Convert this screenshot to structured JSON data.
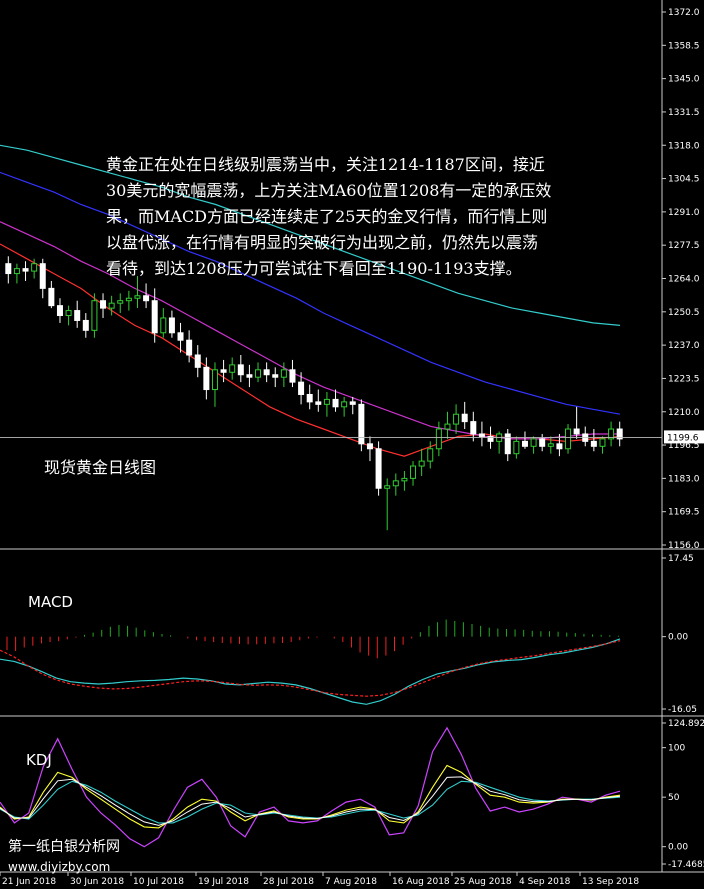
{
  "chart_data": {
    "type": "candlestick",
    "annotation_lines": [
      "黄金正在处在日线级别震荡当中，关注1214-1187区间，接近",
      "30美元的宽幅震荡，上方关注MA60位置1208有一定的承压效",
      "果，而MACD方面已经连续走了25天的金叉行情，而行情上则",
      "以盘代涨，在行情有明显的突破行为出现之前，仍然先以震荡",
      "看待，到达1208压力可尝试往下看回至1190-1193支撑。"
    ],
    "chart_label": "现货黄金日线图",
    "current_price": "1199.6",
    "price_ticks": [
      "1372.0",
      "1358.5",
      "1345.0",
      "1331.5",
      "1318.0",
      "1304.5",
      "1291.0",
      "1277.5",
      "1264.0",
      "1250.5",
      "1237.0",
      "1223.5",
      "1210.0",
      "1196.5",
      "1183.0",
      "1169.5",
      "1156.0"
    ],
    "ylim": [
      1156.0,
      1372.0
    ],
    "x_ticks": [
      "21 Jun 2018",
      "30 Jun 2018",
      "10 Jul 2018",
      "19 Jul 2018",
      "28 Jul 2018",
      "7 Aug 2018",
      "16 Aug 2018",
      "25 Aug 2018",
      "4 Sep 2018",
      "13 Sep 2018"
    ],
    "candles": [
      {
        "o": 1270,
        "h": 1273,
        "l": 1262,
        "c": 1266
      },
      {
        "o": 1266,
        "h": 1270,
        "l": 1262,
        "c": 1268
      },
      {
        "o": 1268,
        "h": 1271,
        "l": 1263,
        "c": 1267
      },
      {
        "o": 1267,
        "h": 1272,
        "l": 1264,
        "c": 1270
      },
      {
        "o": 1270,
        "h": 1272,
        "l": 1256,
        "c": 1260
      },
      {
        "o": 1260,
        "h": 1263,
        "l": 1252,
        "c": 1253
      },
      {
        "o": 1253,
        "h": 1256,
        "l": 1246,
        "c": 1249
      },
      {
        "o": 1249,
        "h": 1253,
        "l": 1245,
        "c": 1251
      },
      {
        "o": 1251,
        "h": 1255,
        "l": 1244,
        "c": 1247
      },
      {
        "o": 1247,
        "h": 1250,
        "l": 1240,
        "c": 1243
      },
      {
        "o": 1243,
        "h": 1258,
        "l": 1240,
        "c": 1255
      },
      {
        "o": 1255,
        "h": 1258,
        "l": 1248,
        "c": 1252
      },
      {
        "o": 1252,
        "h": 1257,
        "l": 1249,
        "c": 1254
      },
      {
        "o": 1254,
        "h": 1258,
        "l": 1250,
        "c": 1255
      },
      {
        "o": 1255,
        "h": 1259,
        "l": 1251,
        "c": 1256
      },
      {
        "o": 1256,
        "h": 1265,
        "l": 1252,
        "c": 1257
      },
      {
        "o": 1257,
        "h": 1262,
        "l": 1252,
        "c": 1255
      },
      {
        "o": 1255,
        "h": 1260,
        "l": 1238,
        "c": 1242
      },
      {
        "o": 1242,
        "h": 1252,
        "l": 1240,
        "c": 1248
      },
      {
        "o": 1248,
        "h": 1251,
        "l": 1240,
        "c": 1242
      },
      {
        "o": 1242,
        "h": 1246,
        "l": 1234,
        "c": 1239
      },
      {
        "o": 1239,
        "h": 1243,
        "l": 1230,
        "c": 1233
      },
      {
        "o": 1233,
        "h": 1237,
        "l": 1224,
        "c": 1228
      },
      {
        "o": 1228,
        "h": 1232,
        "l": 1215,
        "c": 1219
      },
      {
        "o": 1219,
        "h": 1230,
        "l": 1212,
        "c": 1227
      },
      {
        "o": 1227,
        "h": 1231,
        "l": 1222,
        "c": 1226
      },
      {
        "o": 1226,
        "h": 1232,
        "l": 1223,
        "c": 1229
      },
      {
        "o": 1229,
        "h": 1233,
        "l": 1222,
        "c": 1225
      },
      {
        "o": 1225,
        "h": 1229,
        "l": 1220,
        "c": 1224
      },
      {
        "o": 1224,
        "h": 1230,
        "l": 1222,
        "c": 1227
      },
      {
        "o": 1227,
        "h": 1230,
        "l": 1222,
        "c": 1225
      },
      {
        "o": 1225,
        "h": 1228,
        "l": 1220,
        "c": 1224
      },
      {
        "o": 1224,
        "h": 1230,
        "l": 1220,
        "c": 1227
      },
      {
        "o": 1227,
        "h": 1231,
        "l": 1220,
        "c": 1222
      },
      {
        "o": 1222,
        "h": 1226,
        "l": 1213,
        "c": 1217
      },
      {
        "o": 1217,
        "h": 1221,
        "l": 1211,
        "c": 1214
      },
      {
        "o": 1214,
        "h": 1219,
        "l": 1210,
        "c": 1213
      },
      {
        "o": 1213,
        "h": 1218,
        "l": 1208,
        "c": 1215
      },
      {
        "o": 1215,
        "h": 1219,
        "l": 1210,
        "c": 1212
      },
      {
        "o": 1212,
        "h": 1216,
        "l": 1208,
        "c": 1214
      },
      {
        "o": 1214,
        "h": 1216,
        "l": 1209,
        "c": 1213
      },
      {
        "o": 1213,
        "h": 1215,
        "l": 1194,
        "c": 1197
      },
      {
        "o": 1197,
        "h": 1200,
        "l": 1190,
        "c": 1195
      },
      {
        "o": 1195,
        "h": 1198,
        "l": 1176,
        "c": 1179
      },
      {
        "o": 1179,
        "h": 1183,
        "l": 1162,
        "c": 1180
      },
      {
        "o": 1180,
        "h": 1185,
        "l": 1176,
        "c": 1182
      },
      {
        "o": 1182,
        "h": 1186,
        "l": 1178,
        "c": 1183
      },
      {
        "o": 1183,
        "h": 1190,
        "l": 1180,
        "c": 1188
      },
      {
        "o": 1188,
        "h": 1195,
        "l": 1184,
        "c": 1190
      },
      {
        "o": 1190,
        "h": 1198,
        "l": 1187,
        "c": 1195
      },
      {
        "o": 1195,
        "h": 1206,
        "l": 1192,
        "c": 1203
      },
      {
        "o": 1203,
        "h": 1210,
        "l": 1199,
        "c": 1205
      },
      {
        "o": 1205,
        "h": 1213,
        "l": 1201,
        "c": 1209
      },
      {
        "o": 1209,
        "h": 1214,
        "l": 1203,
        "c": 1206
      },
      {
        "o": 1206,
        "h": 1210,
        "l": 1198,
        "c": 1201
      },
      {
        "o": 1201,
        "h": 1206,
        "l": 1196,
        "c": 1200
      },
      {
        "o": 1200,
        "h": 1204,
        "l": 1195,
        "c": 1198
      },
      {
        "o": 1198,
        "h": 1202,
        "l": 1193,
        "c": 1201
      },
      {
        "o": 1201,
        "h": 1203,
        "l": 1190,
        "c": 1193
      },
      {
        "o": 1193,
        "h": 1200,
        "l": 1191,
        "c": 1198
      },
      {
        "o": 1198,
        "h": 1202,
        "l": 1195,
        "c": 1196
      },
      {
        "o": 1196,
        "h": 1200,
        "l": 1193,
        "c": 1199
      },
      {
        "o": 1199,
        "h": 1201,
        "l": 1194,
        "c": 1196
      },
      {
        "o": 1196,
        "h": 1200,
        "l": 1193,
        "c": 1197
      },
      {
        "o": 1197,
        "h": 1201,
        "l": 1192,
        "c": 1195
      },
      {
        "o": 1195,
        "h": 1205,
        "l": 1193,
        "c": 1203
      },
      {
        "o": 1203,
        "h": 1212,
        "l": 1199,
        "c": 1201
      },
      {
        "o": 1201,
        "h": 1204,
        "l": 1196,
        "c": 1198
      },
      {
        "o": 1198,
        "h": 1203,
        "l": 1194,
        "c": 1196
      },
      {
        "o": 1196,
        "h": 1200,
        "l": 1193,
        "c": 1199
      },
      {
        "o": 1199,
        "h": 1206,
        "l": 1196,
        "c": 1203
      },
      {
        "o": 1203,
        "h": 1206,
        "l": 1196,
        "c": 1199
      }
    ],
    "ma_series": [
      {
        "color": "#ff3030",
        "values": [
          1278,
          1272,
          1266,
          1260,
          1252,
          1245,
          1240,
          1233,
          1226,
          1219,
          1212,
          1207,
          1203,
          1199,
          1195,
          1192,
          1196,
          1200,
          1201,
          1199,
          1199,
          1198,
          1199,
          1200
        ]
      },
      {
        "color": "#cc33cc",
        "values": [
          1287,
          1282,
          1277,
          1271,
          1266,
          1260,
          1255,
          1249,
          1243,
          1237,
          1231,
          1225,
          1220,
          1216,
          1212,
          1208,
          1204,
          1202,
          1200,
          1199,
          1199,
          1200,
          1201,
          1201
        ]
      },
      {
        "color": "#3333ff",
        "values": [
          1307,
          1303,
          1299,
          1294,
          1290,
          1285,
          1280,
          1275,
          1271,
          1266,
          1261,
          1256,
          1250,
          1245,
          1240,
          1235,
          1230,
          1226,
          1222,
          1219,
          1216,
          1213,
          1211,
          1209
        ]
      },
      {
        "color": "#33cccc",
        "values": [
          1318,
          1316,
          1313,
          1310,
          1307,
          1304,
          1301,
          1297,
          1294,
          1290,
          1286,
          1282,
          1278,
          1274,
          1270,
          1266,
          1262,
          1258,
          1255,
          1252,
          1250,
          1248,
          1246,
          1245
        ]
      }
    ],
    "macd": {
      "label": "MACD",
      "ticks": [
        "17.45",
        "0.00",
        "-16.05"
      ],
      "ylim": [
        -16.05,
        17.45
      ],
      "histogram": [
        -3.0,
        -3.2,
        -2.4,
        -2.0,
        -1.5,
        -1.2,
        -1.0,
        -0.6,
        -0.2,
        0.4,
        0.9,
        1.5,
        2.2,
        2.6,
        2.4,
        2.0,
        1.4,
        1.0,
        0.6,
        0.3,
        0.0,
        -0.4,
        -0.8,
        -1.0,
        -1.2,
        -1.4,
        -1.5,
        -1.6,
        -1.7,
        -1.7,
        -1.6,
        -1.5,
        -1.4,
        -1.2,
        -0.8,
        -0.4,
        -0.2,
        0.0,
        -0.4,
        -1.2,
        -2.4,
        -3.5,
        -4.2,
        -4.8,
        -4.2,
        -3.2,
        -1.8,
        -0.4,
        1.0,
        2.4,
        3.2,
        3.8,
        3.5,
        3.2,
        2.8,
        2.4,
        2.0,
        1.8,
        1.7,
        1.6,
        1.5,
        1.3,
        1.2,
        1.2,
        1.1,
        0.9,
        0.8,
        0.6,
        0.5,
        0.4,
        0.3,
        0.2
      ],
      "line": [
        -5,
        -5.5,
        -6.5,
        -7.8,
        -9.2,
        -10,
        -10.3,
        -10.5,
        -10.3,
        -10,
        -9.8,
        -9.7,
        -9.5,
        -9.2,
        -9.4,
        -9.8,
        -10.5,
        -10.7,
        -10.4,
        -10.1,
        -10.3,
        -10.7,
        -11.5,
        -12.5,
        -13.5,
        -14.5,
        -15,
        -14.2,
        -12.8,
        -11,
        -9.5,
        -8.3,
        -7.6,
        -7,
        -6.2,
        -5.6,
        -5.3,
        -5.1,
        -4.6,
        -4.0,
        -3.6,
        -3.0,
        -2.4,
        -1.6,
        -0.5
      ],
      "signal": [
        -3,
        -4.5,
        -6.5,
        -8.3,
        -9.6,
        -10.5,
        -11,
        -11.4,
        -11.6,
        -11.5,
        -11.2,
        -10.8,
        -10.4,
        -10.0,
        -9.8,
        -9.9,
        -10.2,
        -10.6,
        -10.8,
        -10.7,
        -10.8,
        -11.2,
        -11.8,
        -12.4,
        -12.8,
        -13.0,
        -13.2,
        -13.0,
        -12.4,
        -11.4,
        -10.2,
        -9.0,
        -7.8,
        -6.8,
        -6.0,
        -5.4,
        -5.0,
        -4.6,
        -4.2,
        -3.7,
        -3.2,
        -2.7,
        -2.2,
        -1.6,
        -0.9
      ],
      "line_color": "#33cccc",
      "signal_color": "#ff2020"
    },
    "kdj": {
      "label": "KDJ",
      "ticks": [
        "124.8922",
        "100",
        "50",
        "0.00",
        "-17.4685"
      ],
      "ylim": [
        -17.4685,
        124.8922
      ],
      "K": [
        40,
        28,
        30,
        55,
        75,
        70,
        58,
        48,
        38,
        28,
        20,
        19,
        28,
        40,
        48,
        46,
        35,
        26,
        33,
        36,
        30,
        28,
        28,
        32,
        37,
        40,
        38,
        26,
        24,
        35,
        60,
        82,
        75,
        63,
        52,
        50,
        45,
        44,
        45,
        48,
        48,
        47,
        50,
        52
      ],
      "D": [
        38,
        30,
        28,
        42,
        58,
        66,
        62,
        55,
        46,
        38,
        30,
        24,
        24,
        30,
        38,
        44,
        42,
        34,
        32,
        34,
        32,
        30,
        29,
        30,
        33,
        36,
        37,
        33,
        29,
        32,
        42,
        58,
        66,
        65,
        60,
        55,
        50,
        47,
        46,
        47,
        48,
        48,
        49,
        50
      ],
      "J": [
        45,
        24,
        34,
        81,
        109,
        78,
        50,
        34,
        22,
        8,
        0,
        9,
        36,
        60,
        68,
        50,
        21,
        10,
        35,
        40,
        26,
        24,
        26,
        36,
        45,
        48,
        40,
        12,
        14,
        41,
        96,
        120,
        93,
        59,
        36,
        40,
        35,
        38,
        43,
        50,
        48,
        45,
        52,
        56
      ],
      "K_color": "#ffffff",
      "D_color": "#ffff33",
      "J_color": "#cc44ff",
      "extra_color": "#33cccc"
    },
    "watermark": [
      "第一纸白银分析网",
      "www.diyizby.com"
    ]
  }
}
